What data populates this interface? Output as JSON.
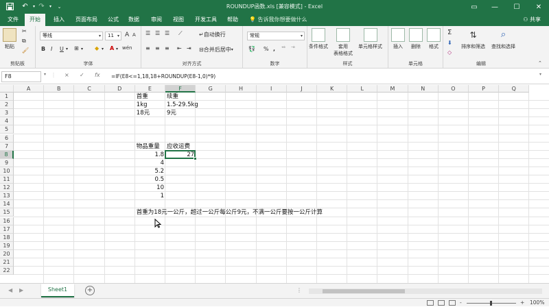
{
  "title_bar": {
    "doc_title": "ROUNDUP函数.xls  [兼容模式]  -  Excel",
    "save_icon": "save-icon",
    "undo_icon": "undo-icon",
    "redo_icon": "redo-icon"
  },
  "tabs": [
    "文件",
    "开始",
    "插入",
    "页面布局",
    "公式",
    "数据",
    "审阅",
    "视图",
    "开发工具",
    "帮助"
  ],
  "active_tab_index": 1,
  "tell_me": "告诉我你想要做什么",
  "share": "共享",
  "ribbon": {
    "clipboard": {
      "paste": "粘贴",
      "label": "剪贴板"
    },
    "font": {
      "name": "等线",
      "size": "11",
      "bold": "B",
      "italic": "I",
      "underline": "U",
      "grow": "A",
      "shrink": "A",
      "wen": "wén",
      "label": "字体"
    },
    "alignment": {
      "wrap": "自动换行",
      "merge": "合并后居中",
      "label": "对齐方式"
    },
    "number": {
      "format": "常规",
      "percent": "%",
      "comma": ",",
      "label": "数字"
    },
    "styles": {
      "conditional": "条件格式",
      "table1": "套用",
      "table2": "表格格式",
      "cell_styles": "单元格样式",
      "label": "样式"
    },
    "cells": {
      "insert": "插入",
      "delete": "删除",
      "format": "格式",
      "label": "单元格"
    },
    "editing": {
      "sort": "排序和筛选",
      "find": "查找和选择",
      "label": "编辑"
    }
  },
  "formula_bar": {
    "name_box": "F8",
    "cancel": "×",
    "enter": "✓",
    "fx": "fx",
    "formula": "=IF(E8<=1,18,18+ROUNDUP(E8-1,0)*9)"
  },
  "columns": [
    "A",
    "B",
    "C",
    "D",
    "E",
    "F",
    "G",
    "H",
    "I",
    "J",
    "K",
    "L",
    "M",
    "N",
    "O",
    "P",
    "Q"
  ],
  "rows": [
    "1",
    "2",
    "3",
    "4",
    "5",
    "6",
    "7",
    "8",
    "9",
    "10",
    "11",
    "12",
    "13",
    "14",
    "15",
    "16",
    "17",
    "18",
    "19",
    "20",
    "21",
    "22"
  ],
  "cells": {
    "E1": "首重",
    "F1": "续重",
    "E2": "1kg",
    "F2": "1.5-29.5kg",
    "E3": "18元",
    "F3": "9元",
    "E7": "物品重量",
    "F7": "应收运费",
    "E8": "1.8",
    "F8": "27",
    "E9": "4",
    "E10": "5.2",
    "E11": "0.5",
    "E12": "10",
    "E13": "1",
    "E15": "首重为18元一公斤，超过一公斤每公斤9元，不满一公斤要按一公斤计算"
  },
  "selected_cell": "F8",
  "sheet_tab": "Sheet1",
  "add_sheet": "+",
  "status": {
    "zoom": "100%",
    "minus": "-",
    "plus": "+"
  }
}
